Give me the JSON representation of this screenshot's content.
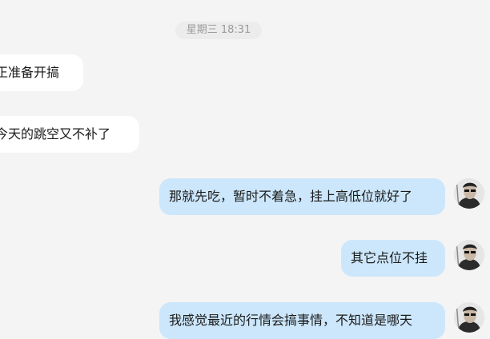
{
  "chat": {
    "timestamp": "星期三 18:31",
    "messages": [
      {
        "side": "left",
        "text": "正准备开搞"
      },
      {
        "side": "left",
        "text": "今天的跳空又不补了"
      },
      {
        "side": "right",
        "text": "那就先吃，暂时不着急，挂上高低位就好了"
      },
      {
        "side": "right",
        "text": "其它点位不挂"
      },
      {
        "side": "right",
        "text": "我感觉最近的行情会搞事情，不知道是哪天"
      }
    ]
  },
  "colors": {
    "background": "#f4f4f4",
    "incoming_bubble": "#ffffff",
    "outgoing_bubble": "#cce7fb",
    "timestamp_text": "#9b9b9b"
  },
  "icons": {
    "avatar": "user-avatar-photo"
  }
}
